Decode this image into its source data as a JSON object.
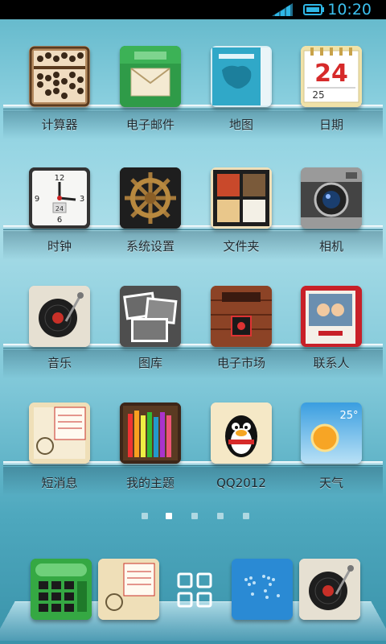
{
  "status_bar": {
    "time": "10:20"
  },
  "apps": [
    {
      "label": "计算器",
      "icon": "abacus-icon"
    },
    {
      "label": "电子邮件",
      "icon": "mail-icon"
    },
    {
      "label": "地图",
      "icon": "map-icon"
    },
    {
      "label": "日期",
      "icon": "calendar-icon",
      "date_big": "24",
      "date_small": "25"
    },
    {
      "label": "时钟",
      "icon": "clock-icon",
      "clock_date": "24"
    },
    {
      "label": "系统设置",
      "icon": "ship-wheel-icon"
    },
    {
      "label": "文件夹",
      "icon": "folder-icon"
    },
    {
      "label": "相机",
      "icon": "camera-icon"
    },
    {
      "label": "音乐",
      "icon": "record-player-icon"
    },
    {
      "label": "图库",
      "icon": "photo-gallery-icon"
    },
    {
      "label": "电子市场",
      "icon": "market-icon"
    },
    {
      "label": "联系人",
      "icon": "contacts-album-icon"
    },
    {
      "label": "短消息",
      "icon": "message-letter-icon"
    },
    {
      "label": "我的主题",
      "icon": "pencils-icon"
    },
    {
      "label": "QQ2012",
      "icon": "qq-penguin-icon"
    },
    {
      "label": "天气",
      "icon": "weather-sun-icon",
      "temperature": "25°"
    }
  ],
  "page_indicator": {
    "count": 5,
    "active": 1
  },
  "dock": [
    {
      "icon": "phone-dialer-icon"
    },
    {
      "icon": "message-letter-icon"
    },
    {
      "icon": "app-drawer-icon"
    },
    {
      "icon": "browser-world-map-icon"
    },
    {
      "icon": "record-player-icon"
    }
  ],
  "colors": {
    "status_time": "#3cc0ee",
    "background": "#8fd2e1"
  }
}
